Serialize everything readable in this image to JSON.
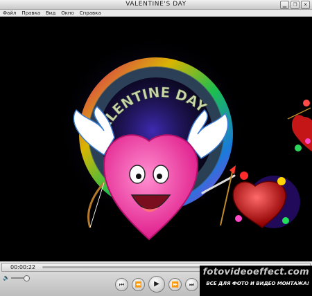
{
  "window": {
    "title": "VALENTINE'S DAY"
  },
  "menu": {
    "items": [
      "Файл",
      "Правка",
      "Вид",
      "Окно",
      "Справка"
    ]
  },
  "video": {
    "caption": "VALENTINE DAY"
  },
  "controls": {
    "current_time": "00:00:22",
    "progress": 0.0
  },
  "watermark": {
    "domain": "fotovideoeffect.com",
    "subtitle": "ВСЕ ДЛЯ ФОТО И ВИДЕО МОНТАЖА!"
  },
  "icons": {
    "window": [
      "minimize-icon",
      "restore-icon",
      "close-icon"
    ],
    "transport": [
      "skip-back-icon",
      "rewind-icon",
      "play-icon",
      "fast-forward-icon",
      "skip-forward-icon"
    ],
    "volume": "volume-icon"
  }
}
